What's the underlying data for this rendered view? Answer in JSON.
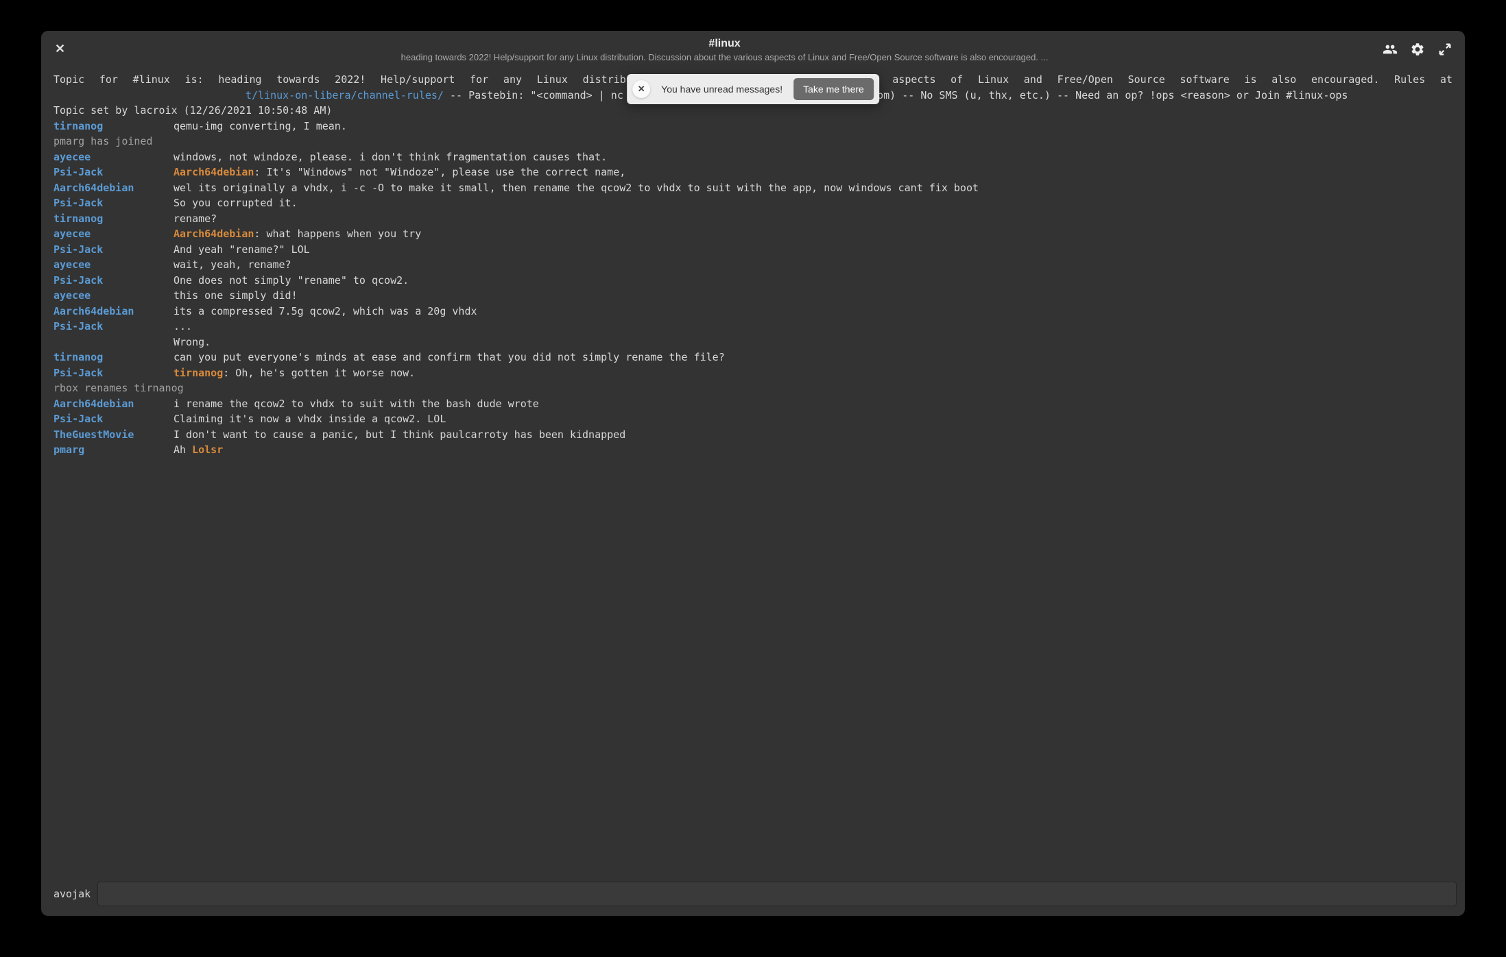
{
  "header": {
    "channel": "#linux",
    "topic_short": "heading towards 2022! Help/support for any Linux distribution. Discussion about the various aspects of Linux and Free/Open Source software is also encouraged. ..."
  },
  "toast": {
    "text": "You have unread messages!",
    "button": "Take me there"
  },
  "topic": {
    "prefix": "Topic for #linux is: ",
    "part1": "heading towards 2022! Help/support for any Linux distribution. Discussion about the various aspects of Linux and Free/Open Source software is also encouraged. Rules at ",
    "link_text": "t/linux-on-libera/channel-rules/",
    "part2": " -- Pastebin: \"<command> | nc termbin.com 9999\" (Do not use pastebin.com) -- No SMS (u, thx, etc.) -- Need an op? !ops <reason> or Join #linux-ops"
  },
  "topic_set_by": "Topic set by lacroix (12/26/2021 10:50:48 AM)",
  "messages": [
    {
      "nick": "tirnanog",
      "text": "qemu-img converting, I mean."
    },
    {
      "status": "pmarg has joined"
    },
    {
      "nick": "ayecee",
      "text": "windows, not windoze, please. i don't think fragmentation causes that."
    },
    {
      "nick": "Psi-Jack",
      "mention": "Aarch64debian",
      "text": ": It's \"Windows\" not \"Windoze\", please use the correct name,"
    },
    {
      "nick": "Aarch64debian",
      "text": "wel its originally a vhdx, i -c -O to make it small, then rename the qcow2 to vhdx to suit with the app, now windows cant fix boot"
    },
    {
      "nick": "Psi-Jack",
      "text": "So you corrupted it."
    },
    {
      "nick": "tirnanog",
      "text": "rename?"
    },
    {
      "nick": "ayecee",
      "mention": "Aarch64debian",
      "text": ": what happens when you try"
    },
    {
      "nick": "Psi-Jack",
      "text": "And yeah \"rename?\" LOL"
    },
    {
      "nick": "ayecee",
      "text": "wait, yeah, rename?"
    },
    {
      "nick": "Psi-Jack",
      "text": "One does not simply \"rename\" to qcow2."
    },
    {
      "nick": "ayecee",
      "text": "this one simply did!"
    },
    {
      "nick": "Aarch64debian",
      "text": "its a compressed 7.5g qcow2, which was a 20g vhdx"
    },
    {
      "nick": "Psi-Jack",
      "text": "..."
    },
    {
      "nick": "",
      "text": "Wrong."
    },
    {
      "nick": "tirnanog",
      "text": "can you put everyone's minds at ease and confirm that you did not simply rename the file?"
    },
    {
      "nick": "Psi-Jack",
      "mention": "tirnanog",
      "text": ": Oh, he's gotten it worse now."
    },
    {
      "status": "rbox renames tirnanog"
    },
    {
      "nick": "Aarch64debian",
      "text": "i rename the qcow2 to vhdx to suit with the bash dude wrote"
    },
    {
      "nick": "Psi-Jack",
      "text": "Claiming it's now a vhdx inside a qcow2. LOL"
    },
    {
      "nick": "TheGuestMovie",
      "text": "I don't want to cause a panic, but I think paulcarroty has been kidnapped"
    },
    {
      "nick": "pmarg",
      "pretext": "Ah ",
      "mention": "Lolsr",
      "text": ""
    }
  ],
  "input": {
    "username": "avojak",
    "value": ""
  }
}
